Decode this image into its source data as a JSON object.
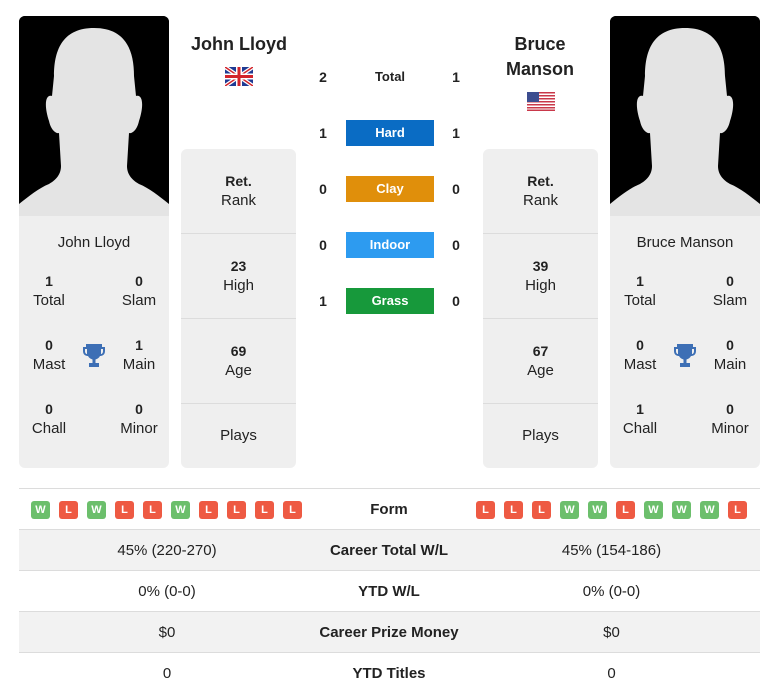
{
  "colors": {
    "hard": "#0a6cc4",
    "clay": "#e08f0b",
    "indoor": "#2d9bf0",
    "grass": "#17993b",
    "win": "#6cbf6c",
    "loss": "#ee5a43",
    "trophy": "#3d6fb5"
  },
  "player1": {
    "name": "John Lloyd",
    "country_flag": "uk-flag",
    "card_name": "John Lloyd",
    "titles": {
      "total": {
        "value": "1",
        "label": "Total"
      },
      "slam": {
        "value": "0",
        "label": "Slam"
      },
      "mast": {
        "value": "0",
        "label": "Mast"
      },
      "main": {
        "value": "1",
        "label": "Main"
      },
      "chall": {
        "value": "0",
        "label": "Chall"
      },
      "minor": {
        "value": "0",
        "label": "Minor"
      }
    },
    "info": {
      "rank": {
        "value": "Ret.",
        "label": "Rank"
      },
      "high": {
        "value": "23",
        "label": "High"
      },
      "age": {
        "value": "69",
        "label": "Age"
      },
      "plays": {
        "value": "",
        "label": "Plays"
      }
    },
    "form": [
      "W",
      "L",
      "W",
      "L",
      "L",
      "W",
      "L",
      "L",
      "L",
      "L"
    ]
  },
  "player2": {
    "name": "Bruce Manson",
    "country_flag": "us-flag",
    "card_name": "Bruce Manson",
    "titles": {
      "total": {
        "value": "1",
        "label": "Total"
      },
      "slam": {
        "value": "0",
        "label": "Slam"
      },
      "mast": {
        "value": "0",
        "label": "Mast"
      },
      "main": {
        "value": "0",
        "label": "Main"
      },
      "chall": {
        "value": "1",
        "label": "Chall"
      },
      "minor": {
        "value": "0",
        "label": "Minor"
      }
    },
    "info": {
      "rank": {
        "value": "Ret.",
        "label": "Rank"
      },
      "high": {
        "value": "39",
        "label": "High"
      },
      "age": {
        "value": "67",
        "label": "Age"
      },
      "plays": {
        "value": "",
        "label": "Plays"
      }
    },
    "form": [
      "L",
      "L",
      "L",
      "W",
      "W",
      "L",
      "W",
      "W",
      "W",
      "L"
    ]
  },
  "h2h": [
    {
      "label": "Total",
      "p1": "2",
      "p2": "1"
    },
    {
      "label": "Hard",
      "p1": "1",
      "p2": "1"
    },
    {
      "label": "Clay",
      "p1": "0",
      "p2": "0"
    },
    {
      "label": "Indoor",
      "p1": "0",
      "p2": "0"
    },
    {
      "label": "Grass",
      "p1": "1",
      "p2": "0"
    }
  ],
  "stats": {
    "form_label": "Form",
    "rows": [
      {
        "label": "Career Total W/L",
        "p1": "45% (220-270)",
        "p2": "45% (154-186)"
      },
      {
        "label": "YTD W/L",
        "p1": "0% (0-0)",
        "p2": "0% (0-0)"
      },
      {
        "label": "Career Prize Money",
        "p1": "$0",
        "p2": "$0"
      },
      {
        "label": "YTD Titles",
        "p1": "0",
        "p2": "0"
      }
    ]
  }
}
